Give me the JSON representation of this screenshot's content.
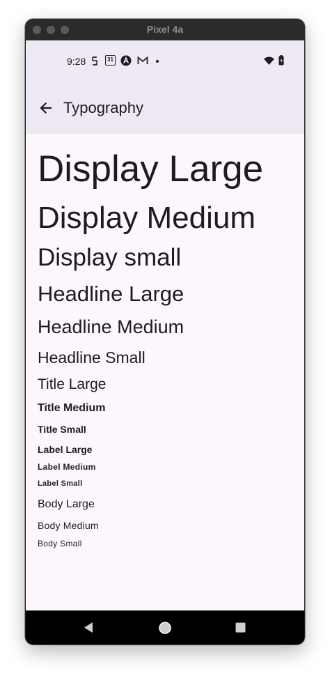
{
  "window": {
    "title": "Pixel 4a"
  },
  "status_bar": {
    "time": "9:28",
    "calendar_day": "31",
    "left_icons": [
      "sync-icon",
      "calendar-icon",
      "assistant-icon",
      "gmail-icon",
      "dot-icon"
    ],
    "right_icons": [
      "wifi-icon",
      "battery-icon"
    ]
  },
  "app_bar": {
    "title": "Typography",
    "back_icon": "arrow-back-icon"
  },
  "typography_samples": [
    "Display Large",
    "Display Medium",
    "Display small",
    "Headline Large",
    "Headline Medium",
    "Headline Small",
    "Title Large",
    "Title Medium",
    "Title Small",
    "Label Large",
    "Label Medium",
    "Label Small",
    "Body Large",
    "Body Medium",
    "Body Small"
  ],
  "nav_bar": {
    "icons": [
      "back-triangle-icon",
      "home-circle-icon",
      "recents-square-icon"
    ]
  },
  "colors": {
    "app_bar_bg": "#efe9f4",
    "screen_bg": "#fdf7fd",
    "text": "#1d1b20"
  }
}
